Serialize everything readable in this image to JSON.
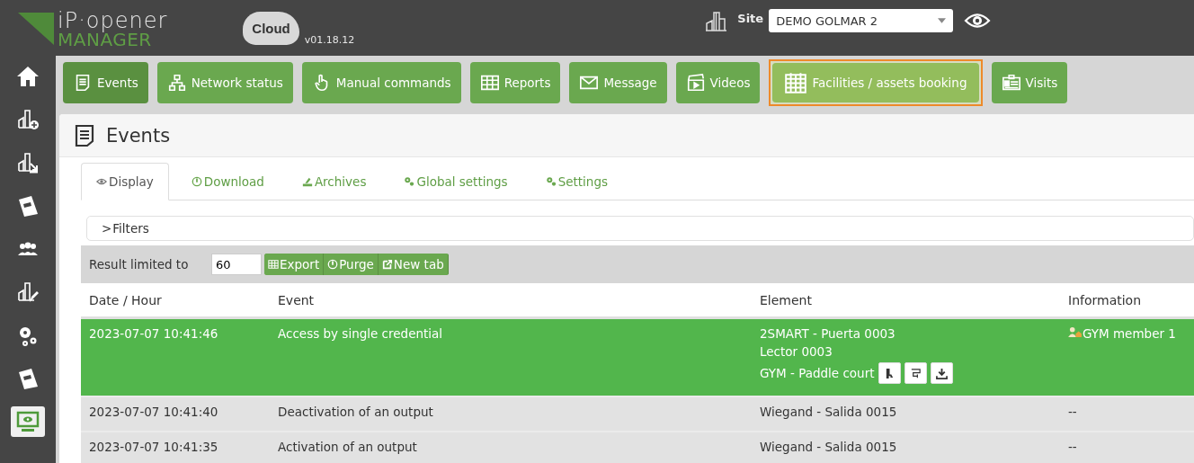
{
  "header": {
    "logo_line_1": "iP·opener",
    "logo_line_2": "MANAGER",
    "cloud_label": "Cloud",
    "version": "v01.18.12",
    "site_label": "Site",
    "site": "DEMO GOLMAR 2"
  },
  "sidebar": {
    "items": [
      {
        "kind": "home",
        "selected": false
      },
      {
        "kind": "building-plus",
        "selected": false
      },
      {
        "kind": "building-arrow",
        "selected": false
      },
      {
        "kind": "notebook",
        "selected": false
      },
      {
        "kind": "people",
        "selected": false
      },
      {
        "kind": "building-pencil",
        "selected": false
      },
      {
        "kind": "gears",
        "selected": false
      },
      {
        "kind": "notebook",
        "selected": false
      },
      {
        "kind": "monitor",
        "selected": true
      }
    ]
  },
  "nav": {
    "buttons": [
      {
        "label": "Events",
        "kind": "document",
        "selected": true,
        "highlighted": false
      },
      {
        "label": "Network status",
        "kind": "network",
        "selected": false,
        "highlighted": false
      },
      {
        "label": "Manual commands",
        "kind": "hand",
        "selected": false,
        "highlighted": false
      },
      {
        "label": "Reports",
        "kind": "table",
        "selected": false,
        "highlighted": false
      },
      {
        "label": "Message",
        "kind": "envelope",
        "selected": false,
        "highlighted": false
      },
      {
        "label": "Videos",
        "kind": "clapper",
        "selected": false,
        "highlighted": false
      },
      {
        "label": "Facilities / assets booking",
        "kind": "calendar",
        "selected": false,
        "highlighted": true
      },
      {
        "label": "Visits",
        "kind": "badge",
        "selected": false,
        "highlighted": false
      }
    ]
  },
  "page": {
    "title": "Events",
    "tabs": [
      {
        "label": "Display",
        "kind": "eye",
        "selected": true
      },
      {
        "label": "Download",
        "kind": "download",
        "selected": false
      },
      {
        "label": "Archives",
        "kind": "archive",
        "selected": false
      },
      {
        "label": "Global settings",
        "kind": "gears",
        "selected": false
      },
      {
        "label": "Settings",
        "kind": "gears",
        "selected": false
      }
    ],
    "filters": {
      "caret": ">",
      "label": "Filters"
    },
    "result_limit": {
      "label": "Result limited to",
      "value": "60"
    },
    "actions": [
      {
        "label": "Export",
        "kind": "table"
      },
      {
        "label": "Purge",
        "kind": "purge"
      },
      {
        "label": "New tab",
        "kind": "external"
      }
    ]
  },
  "table": {
    "columns": [
      "Date / Hour",
      "Event",
      "Element",
      "Information"
    ],
    "rows": [
      {
        "date": "2023-07-07 10:41:46",
        "event": "Access by single credential",
        "element": [
          "2SMART - Puerta 0003",
          "Lector 0003",
          "GYM - Paddle court"
        ],
        "element_buttons": [
          {
            "kind": "person"
          },
          {
            "kind": "route"
          },
          {
            "kind": "download"
          }
        ],
        "information": {
          "text": "GYM member 1",
          "kind": "user"
        },
        "selected": true
      },
      {
        "date": "2023-07-07 10:41:40",
        "event": "Deactivation of an output",
        "element": [
          "Wiegand - Salida 0015"
        ],
        "information": {
          "text": "--",
          "kind": "text"
        },
        "selected": false
      },
      {
        "date": "2023-07-07 10:41:35",
        "event": "Activation of an output",
        "element": [
          "Wiegand - Salida 0015"
        ],
        "information": {
          "text": "--",
          "kind": "text"
        },
        "selected": false
      }
    ]
  }
}
